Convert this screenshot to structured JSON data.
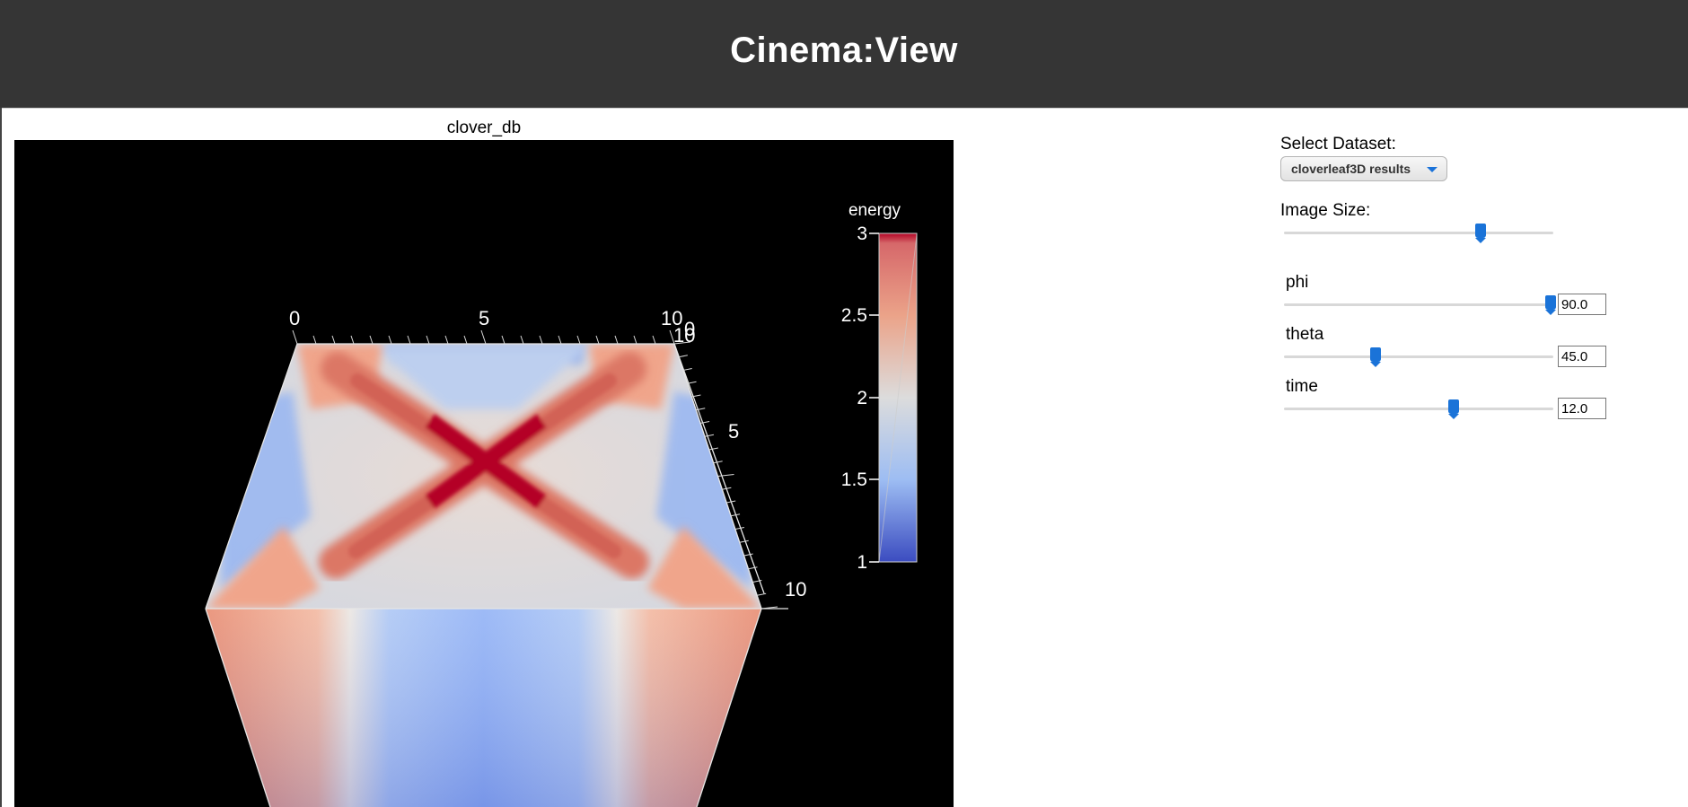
{
  "app": {
    "title": "Cinema:View"
  },
  "viewer": {
    "label": "clover_db",
    "colorbar": {
      "title": "energy",
      "ticks": [
        "3",
        "2.5",
        "2",
        "1.5",
        "1"
      ]
    },
    "axes": {
      "top_ticks": [
        "0",
        "5",
        "10",
        "0"
      ],
      "right_ticks": [
        "10",
        "5",
        "10"
      ]
    },
    "colors": {
      "high": "#b40426",
      "low": "#3b4cc0",
      "mid": "#dddddd"
    }
  },
  "controls": {
    "dataset": {
      "label": "Select Dataset:",
      "value": "cloverleaf3D results"
    },
    "image_size": {
      "label": "Image Size:",
      "fraction": 0.73
    },
    "parameters": [
      {
        "name": "phi",
        "value": "90.0",
        "fraction": 0.99
      },
      {
        "name": "theta",
        "value": "45.0",
        "fraction": 0.34
      },
      {
        "name": "time",
        "value": "12.0",
        "fraction": 0.63
      }
    ]
  }
}
